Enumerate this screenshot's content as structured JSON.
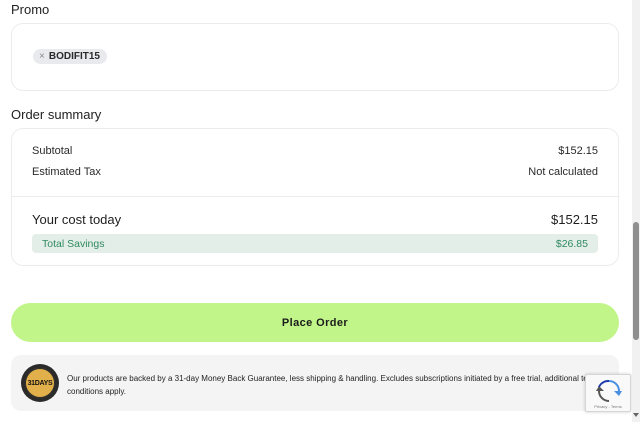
{
  "promo": {
    "title": "Promo",
    "chip": {
      "remove_icon": "×",
      "code": "BODIFIT15"
    }
  },
  "summary": {
    "title": "Order summary",
    "subtotal_label": "Subtotal",
    "subtotal_value": "$152.15",
    "tax_label": "Estimated Tax",
    "tax_value": "Not calculated",
    "total_label": "Your cost today",
    "total_value": "$152.15",
    "savings_label": "Total Savings",
    "savings_value": "$26.85"
  },
  "actions": {
    "place_order": "Place Order"
  },
  "guarantee": {
    "badge_text": "31DAYS",
    "text": "Our products are backed by a 31-day Money Back Guarantee, less shipping & handling. Excludes subscriptions initiated by a free trial, additional terms and conditions apply."
  },
  "recaptcha": {
    "terms": "Privacy - Terms"
  },
  "colors": {
    "accent_button": "#c1f58a",
    "savings_bg": "#e4eee9",
    "savings_text": "#2f8a5f"
  }
}
